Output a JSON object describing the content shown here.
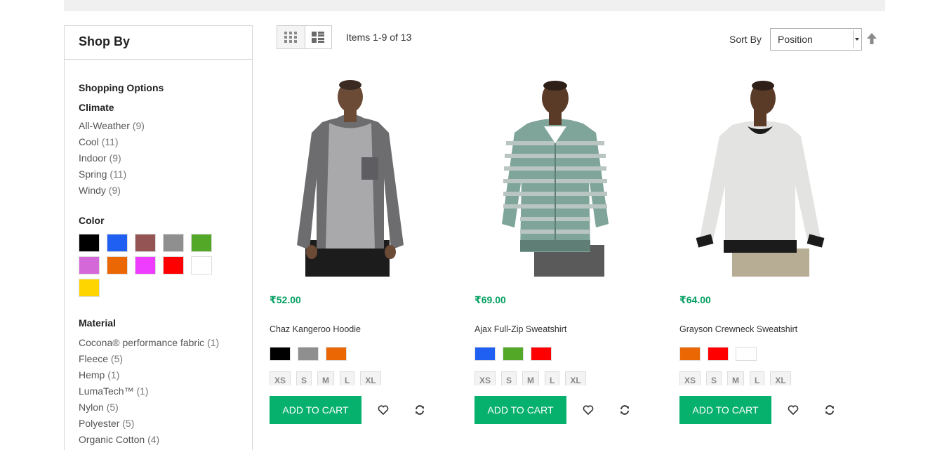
{
  "sidebar": {
    "title": "Shop By",
    "options_title": "Shopping Options",
    "climate": {
      "heading": "Climate",
      "items": [
        {
          "label": "All-Weather",
          "count": "(9)"
        },
        {
          "label": "Cool",
          "count": "(11)"
        },
        {
          "label": "Indoor",
          "count": "(9)"
        },
        {
          "label": "Spring",
          "count": "(11)"
        },
        {
          "label": "Windy",
          "count": "(9)"
        }
      ]
    },
    "color": {
      "heading": "Color",
      "swatches": [
        "#000000",
        "#1f5ff2",
        "#945454",
        "#8f8f8f",
        "#53a828",
        "#d568d9",
        "#eb6703",
        "#ef3dff",
        "#ff0000",
        "#ffffff",
        "#ffd500"
      ]
    },
    "material": {
      "heading": "Material",
      "items": [
        {
          "label": "Cocona® performance fabric",
          "count": "(1)"
        },
        {
          "label": "Fleece",
          "count": "(5)"
        },
        {
          "label": "Hemp",
          "count": "(1)"
        },
        {
          "label": "LumaTech™",
          "count": "(1)"
        },
        {
          "label": "Nylon",
          "count": "(5)"
        },
        {
          "label": "Polyester",
          "count": "(5)"
        },
        {
          "label": "Organic Cotton",
          "count": "(4)"
        }
      ]
    }
  },
  "toolbar": {
    "grid_icon": "grid-icon",
    "list_icon": "list-icon",
    "amount": "Items 1-9 of 13",
    "sort_label": "Sort By",
    "sort_value": "Position",
    "sort_direction_icon": "arrow-up-icon"
  },
  "products": [
    {
      "price": "₹52.00",
      "name": "Chaz Kangeroo Hoodie",
      "colors": [
        "#000000",
        "#8f8f8f",
        "#eb6703"
      ],
      "sizes": [
        "XS",
        "S",
        "M",
        "L",
        "XL"
      ],
      "cart_label": "ADD TO CART"
    },
    {
      "price": "₹69.00",
      "name": "Ajax Full-Zip Sweatshirt",
      "colors": [
        "#1f5ff2",
        "#53a828",
        "#ff0000"
      ],
      "sizes": [
        "XS",
        "S",
        "M",
        "L",
        "XL"
      ],
      "cart_label": "ADD TO CART"
    },
    {
      "price": "₹64.00",
      "name": "Grayson Crewneck Sweatshirt",
      "colors": [
        "#eb6703",
        "#ff0000",
        "#ffffff"
      ],
      "sizes": [
        "XS",
        "S",
        "M",
        "L",
        "XL"
      ],
      "cart_label": "ADD TO CART"
    }
  ],
  "colors": {
    "price": "#06a063",
    "cart_button": "#06b06d"
  }
}
